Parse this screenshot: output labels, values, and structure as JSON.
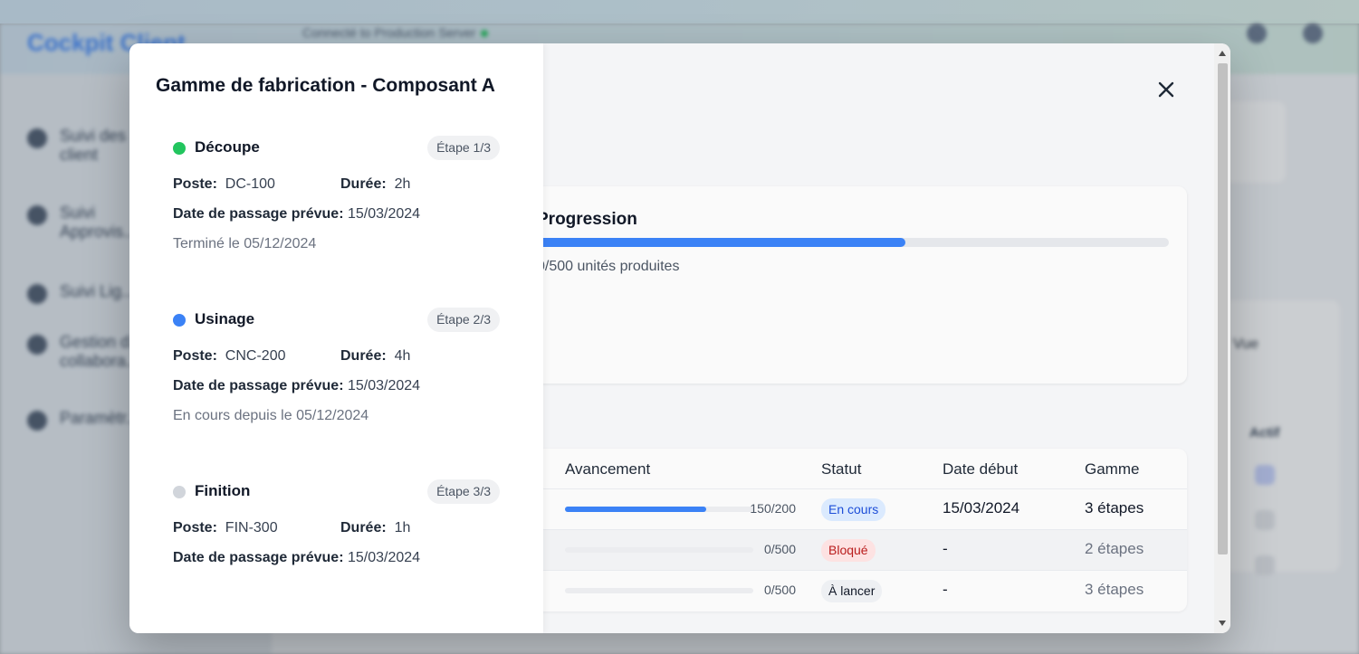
{
  "background": {
    "app_title": "Cockpit Client",
    "connection_status": "Connecté to Production Server",
    "sidebar": [
      {
        "label_1": "Suivi des",
        "label_2": "client"
      },
      {
        "label_1": "Suivi",
        "label_2": "Approvis..."
      },
      {
        "label_1": "Suivi Lig...",
        "label_2": ""
      },
      {
        "label_1": "Gestion d...",
        "label_2": "collabora..."
      },
      {
        "label_1": "Paramètr...",
        "label_2": ""
      }
    ],
    "actions_header": "Actif",
    "view_toggle": "Vue"
  },
  "modal": {
    "progress": {
      "title": "Progression",
      "value_fraction": 0.583,
      "text": "0/500 unités produites"
    },
    "table": {
      "columns": [
        "Avancement",
        "Statut",
        "Date début",
        "Gamme"
      ],
      "rows": [
        {
          "done": "150/200",
          "fraction": 0.75,
          "status": "En cours",
          "status_type": "blue",
          "start": "15/03/2024",
          "gamme": "3 étapes",
          "gamme_muted": false
        },
        {
          "done": "0/500",
          "fraction": 0.0,
          "status": "Bloqué",
          "status_type": "red",
          "start": "-",
          "gamme": "2 étapes",
          "gamme_muted": true
        },
        {
          "done": "0/500",
          "fraction": 0.0,
          "status": "À lancer",
          "status_type": "gray",
          "start": "-",
          "gamme": "3 étapes",
          "gamme_muted": true
        }
      ]
    }
  },
  "panel": {
    "title": "Gamme de fabrication - Composant A",
    "labels": {
      "poste": "Poste:",
      "duree": "Durée:",
      "date": "Date de passage prévue:"
    },
    "steps": [
      {
        "name": "Découpe",
        "badge": "Étape 1/3",
        "dot_color": "#22c55e",
        "poste": "DC-100",
        "duree": "2h",
        "date": "15/03/2024",
        "note": "Terminé le 05/12/2024"
      },
      {
        "name": "Usinage",
        "badge": "Étape 2/3",
        "dot_color": "#3b82f6",
        "poste": "CNC-200",
        "duree": "4h",
        "date": "15/03/2024",
        "note": "En cours depuis le 05/12/2024"
      },
      {
        "name": "Finition",
        "badge": "Étape 3/3",
        "dot_color": "#d1d5db",
        "poste": "FIN-300",
        "duree": "1h",
        "date": "15/03/2024",
        "note": ""
      }
    ]
  }
}
